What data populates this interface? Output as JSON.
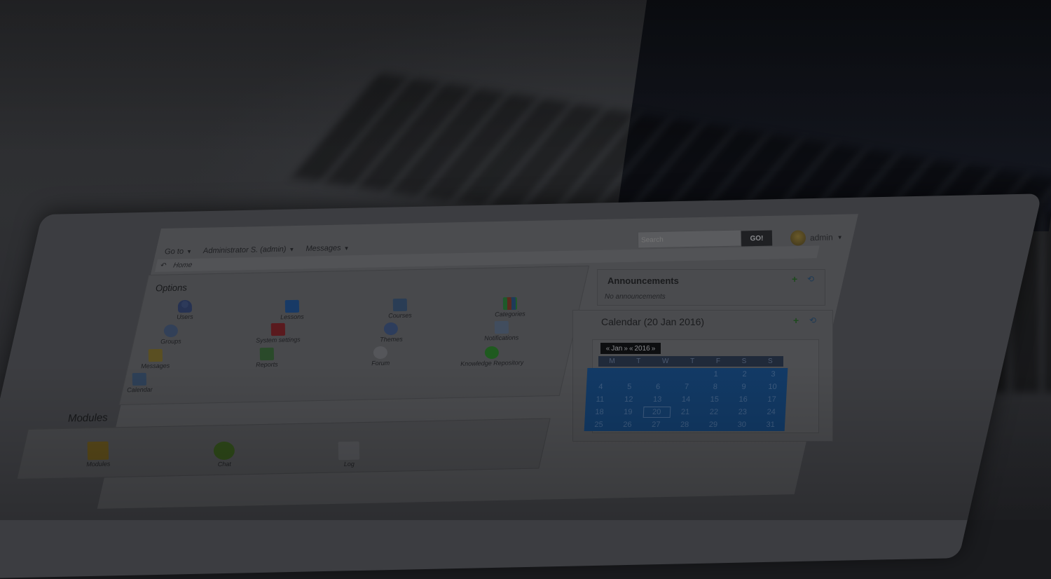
{
  "topbar": {
    "goto_label": "Go to",
    "user_menu_label": "Administrator S. (admin)",
    "messages_label": "Messages",
    "search_placeholder": "Search",
    "go_button": "GO!",
    "username": "admin"
  },
  "breadcrumb": {
    "home": "Home"
  },
  "options": {
    "title": "Options",
    "items": [
      {
        "label": "Users",
        "icon": "users-icon"
      },
      {
        "label": "Lessons",
        "icon": "lessons-icon"
      },
      {
        "label": "Courses",
        "icon": "courses-icon"
      },
      {
        "label": "Categories",
        "icon": "categories-icon"
      },
      {
        "label": "Groups",
        "icon": "groups-icon"
      },
      {
        "label": "System settings",
        "icon": "system-settings-icon"
      },
      {
        "label": "Themes",
        "icon": "themes-icon"
      },
      {
        "label": "Notifications",
        "icon": "notifications-icon"
      },
      {
        "label": "Messages",
        "icon": "messages-icon"
      },
      {
        "label": "Reports",
        "icon": "reports-icon"
      },
      {
        "label": "Forum",
        "icon": "forum-icon"
      },
      {
        "label": "Knowledge Repository",
        "icon": "knowledge-repository-icon"
      },
      {
        "label": "Calendar",
        "icon": "calendar-icon"
      }
    ]
  },
  "modules": {
    "title": "Modules",
    "items": [
      {
        "label": "Modules",
        "icon": "modules-icon"
      },
      {
        "label": "Chat",
        "icon": "chat-icon"
      },
      {
        "label": "Log",
        "icon": "log-icon"
      }
    ]
  },
  "announcements": {
    "title": "Announcements",
    "empty_text": "No announcements"
  },
  "calendar": {
    "title": "Calendar (20 Jan 2016)",
    "nav": {
      "prev": "«",
      "month": "Jan",
      "next": "»",
      "prev_year": "«",
      "year": "2016",
      "next_year": "»"
    },
    "weekdays": [
      "M",
      "T",
      "W",
      "T",
      "F",
      "S",
      "S"
    ],
    "weeks": [
      [
        "",
        "",
        "",
        "",
        "1",
        "2",
        "3"
      ],
      [
        "4",
        "5",
        "6",
        "7",
        "8",
        "9",
        "10"
      ],
      [
        "11",
        "12",
        "13",
        "14",
        "15",
        "16",
        "17"
      ],
      [
        "18",
        "19",
        "20",
        "21",
        "22",
        "23",
        "24"
      ],
      [
        "25",
        "26",
        "27",
        "28",
        "29",
        "30",
        "31"
      ]
    ],
    "today": "20"
  }
}
